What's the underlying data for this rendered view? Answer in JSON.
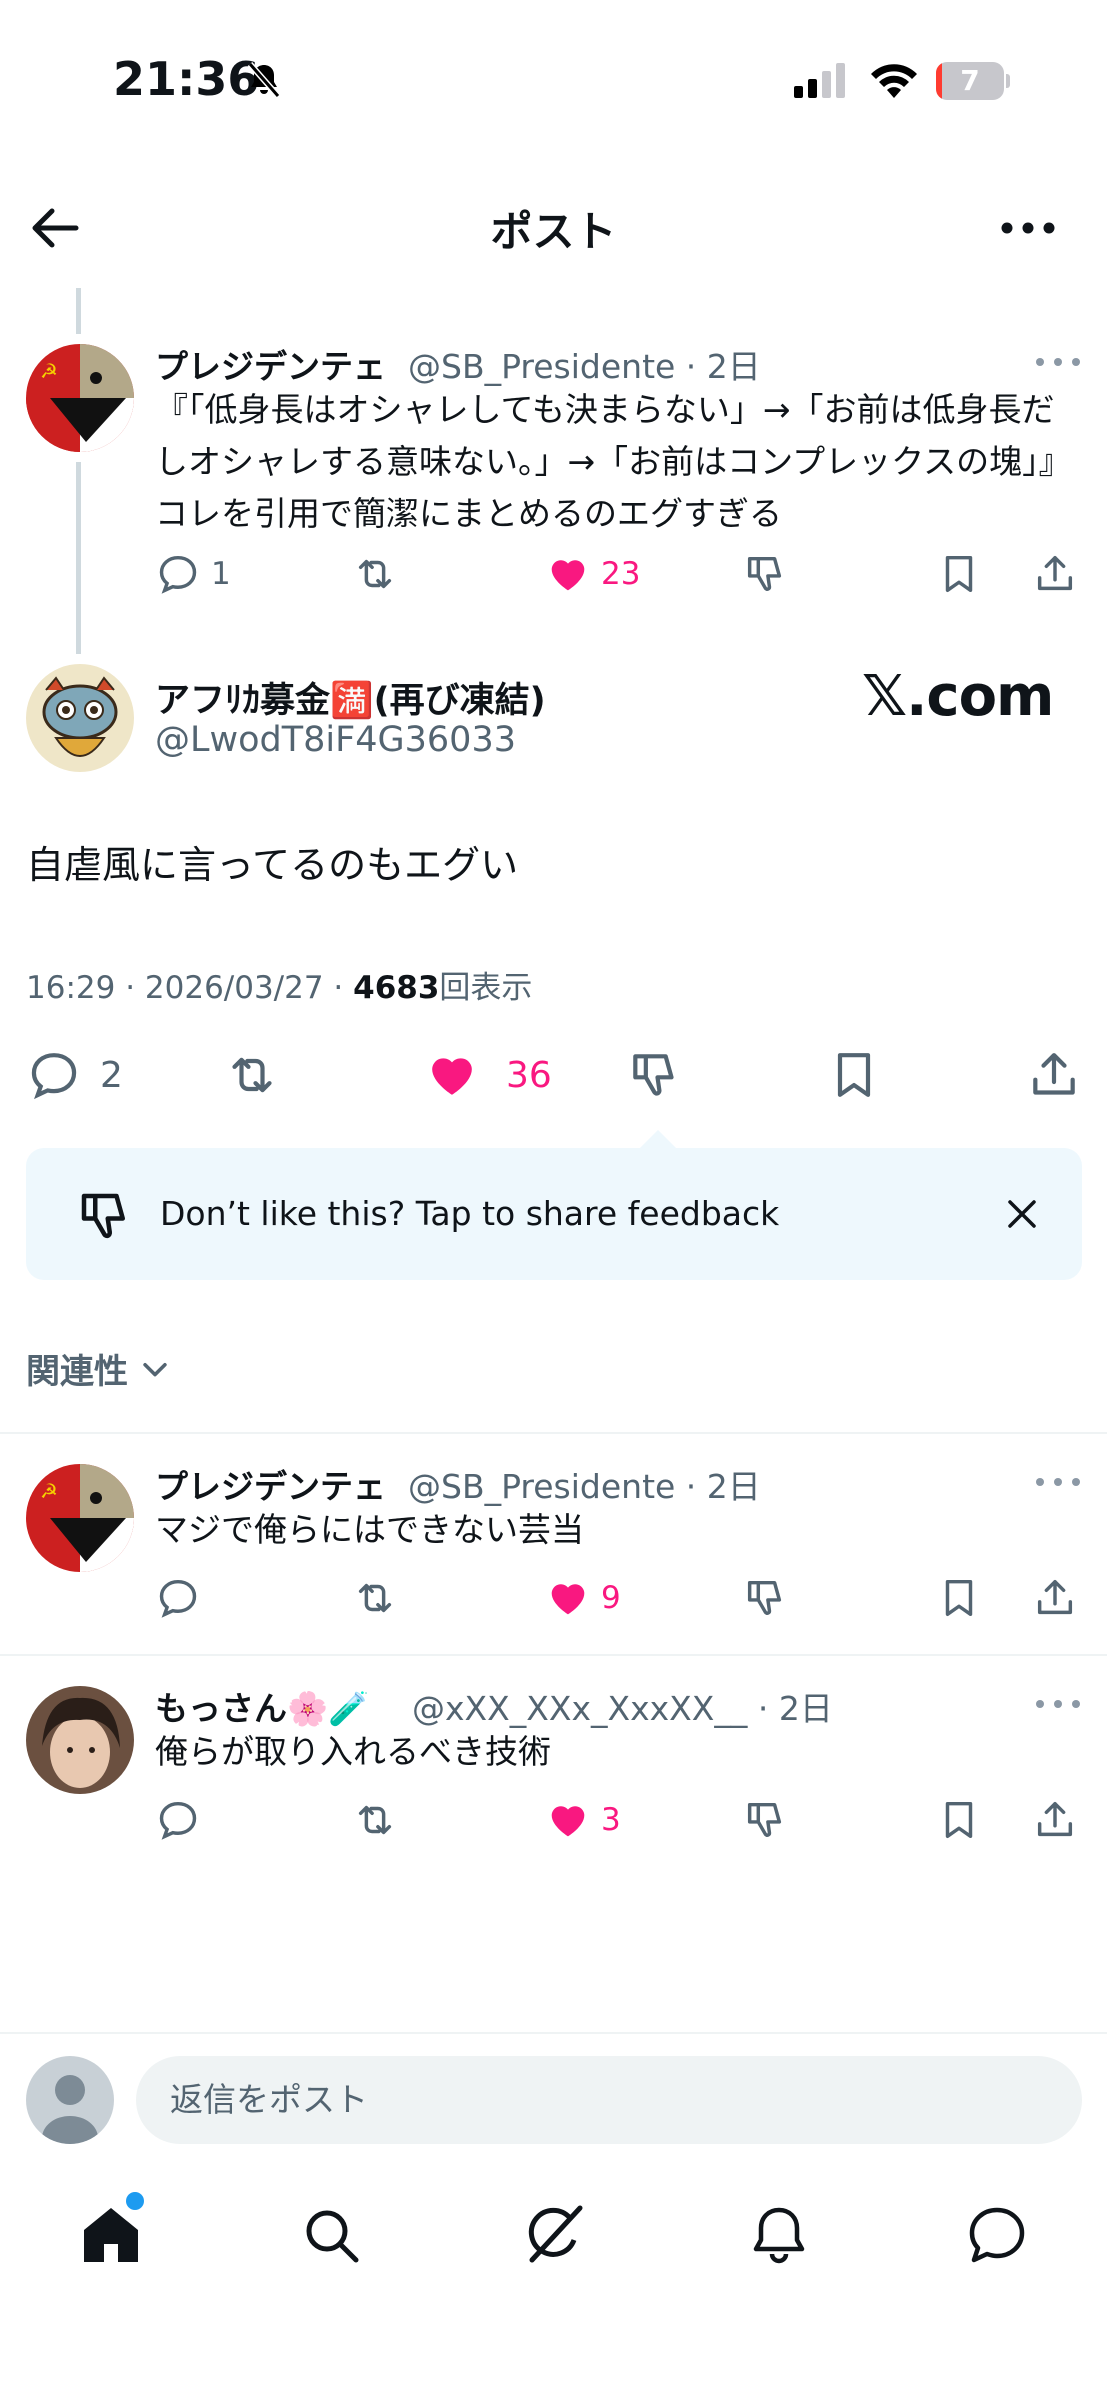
{
  "status_bar": {
    "time": "21:36",
    "battery": "7"
  },
  "header": {
    "title": "ポスト"
  },
  "parent_tweet": {
    "name": "プレジデンテェ",
    "handle_time": "@SB_Presidente · 2日",
    "text": "『「低身長はオシャレしても決まらない」→「お前は低身長だしオシャレする意味ない。」→「お前はコンプレックスの塊」』コレを引用で簡潔にまとめるのエグすぎる",
    "replies": "1",
    "likes": "23"
  },
  "main_tweet": {
    "name": "アフﾘｶ募金🈵(再び凍結)",
    "handle": "@LwodT8iF4G36033",
    "watermark": "𝕏.com",
    "text": "自虐風に言ってるのもエグい",
    "meta_prefix": "16:29 · 2026/03/27 · ",
    "views": "4683",
    "views_suffix": "回表示",
    "replies": "2",
    "likes": "36"
  },
  "feedback": {
    "text": "Don’t like this? Tap to share feedback"
  },
  "sort": {
    "label": "関連性"
  },
  "replies": [
    {
      "name": "プレジデンテェ",
      "handle_time": "@SB_Presidente · 2日",
      "text": "マジで俺らにはできない芸当",
      "likes": "9"
    },
    {
      "name": "もっさん🌸🧪",
      "handle_time": "@xXX_XXx_XxxXX__ · 2日",
      "text": "俺らが取り入れるべき技術",
      "likes": "3"
    }
  ],
  "composer": {
    "placeholder": "返信をポスト"
  },
  "colors": {
    "like": "#f91880",
    "accent": "#1d9bf0",
    "secondary_text": "#536471"
  }
}
